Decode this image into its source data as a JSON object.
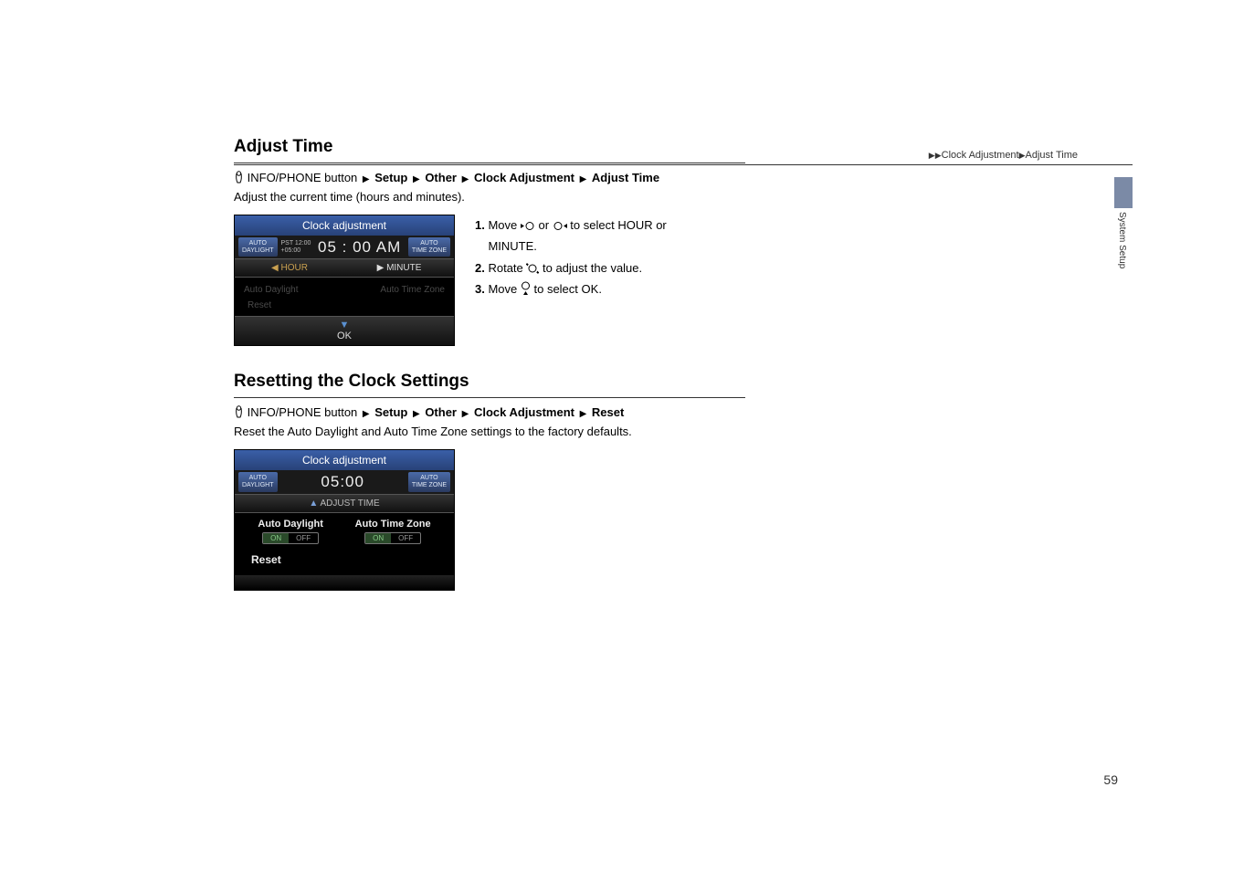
{
  "breadcrumb_top": {
    "arrows": "▶▶",
    "part1": "Clock Adjustment",
    "arrow2": "▶",
    "part2": "Adjust Time"
  },
  "section1": {
    "title": "Adjust Time",
    "crumb_prefix": "INFO/PHONE button",
    "crumb_items": [
      "Setup",
      "Other",
      "Clock Adjustment",
      "Adjust Time"
    ],
    "desc": "Adjust the current time (hours and minutes).",
    "steps": {
      "s1a": "Move ",
      "s1b": " or ",
      "s1c": " to select ",
      "s1_hour": "HOUR",
      "s1d": " or ",
      "s1_minute": "MINUTE",
      "s1e": ".",
      "s2a": "Rotate ",
      "s2b": " to adjust the value.",
      "s3a": "Move ",
      "s3b": " to select ",
      "s3_ok": "OK",
      "s3c": ".",
      "n1": "1.",
      "n2": "2.",
      "n3": "3."
    }
  },
  "section2": {
    "title": "Resetting the Clock Settings",
    "crumb_prefix": "INFO/PHONE button",
    "crumb_items": [
      "Setup",
      "Other",
      "Clock Adjustment",
      "Reset"
    ],
    "desc_a": "Reset the ",
    "desc_b": "Auto Daylight",
    "desc_c": " and ",
    "desc_d": "Auto Time Zone",
    "desc_e": " settings to the factory defaults."
  },
  "screenshot1": {
    "title": "Clock adjustment",
    "auto_daylight": "AUTO\nDAYLIGHT",
    "pst": "PST 12:00\n+05:00",
    "bigtime": "05 : 00 AM",
    "auto_timezone": "AUTO\nTIME ZONE",
    "hour_label": "HOUR",
    "minute_label": "MINUTE",
    "dim_left": "Auto Daylight",
    "dim_right": "Auto Time Zone",
    "reset": "Reset",
    "ok": "OK"
  },
  "screenshot2": {
    "title": "Clock adjustment",
    "auto_daylight": "AUTO\nDAYLIGHT",
    "bigtime": "05:00",
    "auto_timezone": "AUTO\nTIME ZONE",
    "adjust_time": "ADJUST TIME",
    "opt1_label": "Auto Daylight",
    "opt2_label": "Auto Time Zone",
    "on": "ON",
    "off": "OFF",
    "reset": "Reset"
  },
  "side_tab": "System Setup",
  "page_num": "59",
  "tri": "▶",
  "up_tri": "▲",
  "down_tri": "▼"
}
